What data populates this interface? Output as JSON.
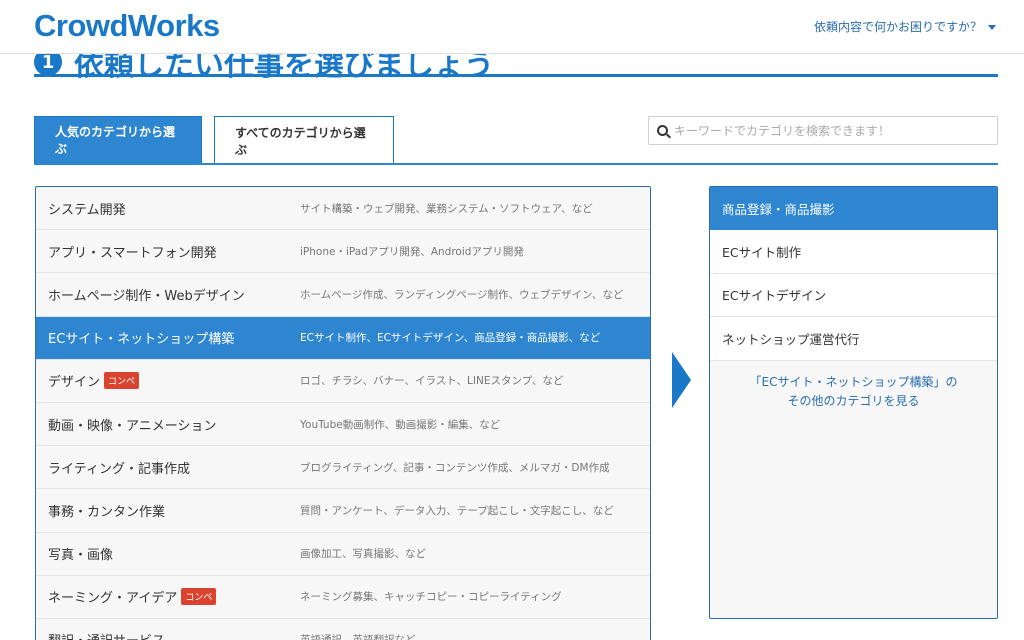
{
  "header": {
    "logo": "CrowdWorks",
    "help_link": "依頼内容で何かお困りですか？"
  },
  "step": {
    "number": "1",
    "title": "依頼したい仕事を選びましょう"
  },
  "tabs": [
    {
      "label": "人気のカテゴリから選ぶ",
      "active": true
    },
    {
      "label": "すべてのカテゴリから選ぶ",
      "active": false
    }
  ],
  "search": {
    "placeholder": "キーワードでカテゴリを検索できます！",
    "value": ""
  },
  "categories": [
    {
      "name": "システム開発",
      "desc": "サイト構築・ウェブ開発、業務システム・ソフトウェア、など"
    },
    {
      "name": "アプリ・スマートフォン開発",
      "desc": "iPhone・iPadアプリ開発、Androidアプリ開発"
    },
    {
      "name": "ホームページ制作・Webデザイン",
      "desc": "ホームページ作成、ランディングページ制作、ウェブデザイン、など"
    },
    {
      "name": "ECサイト・ネットショップ構築",
      "desc": "ECサイト制作、ECサイトデザイン、商品登録・商品撮影、など",
      "selected": true
    },
    {
      "name": "デザイン",
      "badge": "コンペ",
      "desc": "ロゴ、チラシ、バナー、イラスト、LINEスタンプ、など"
    },
    {
      "name": "動画・映像・アニメーション",
      "desc": "YouTube動画制作、動画撮影・編集、など"
    },
    {
      "name": "ライティング・記事作成",
      "desc": "ブログライティング、記事・コンテンツ作成、メルマガ・DM作成"
    },
    {
      "name": "事務・カンタン作業",
      "desc": "質問・アンケート、データ入力、テープ起こし・文字起こし、など"
    },
    {
      "name": "写真・画像",
      "desc": "画像加工、写真撮影、など"
    },
    {
      "name": "ネーミング・アイデア",
      "badge": "コンペ",
      "desc": "ネーミング募集、キャッチコピー・コピーライティング"
    },
    {
      "name": "翻訳・通訳サービス",
      "desc": "英語通訳、英語翻訳など"
    }
  ],
  "subcategories": {
    "header": "商品登録・商品撮影",
    "items": [
      "ECサイト制作",
      "ECサイトデザイン",
      "ネットショップ運営代行"
    ],
    "more_line1": "「ECサイト・ネットショップ構築」の",
    "more_line2": "その他のカテゴリを見る"
  },
  "colors": {
    "brand": "#1a78c8",
    "selected": "#2f86d0",
    "badge": "#d9432f"
  }
}
